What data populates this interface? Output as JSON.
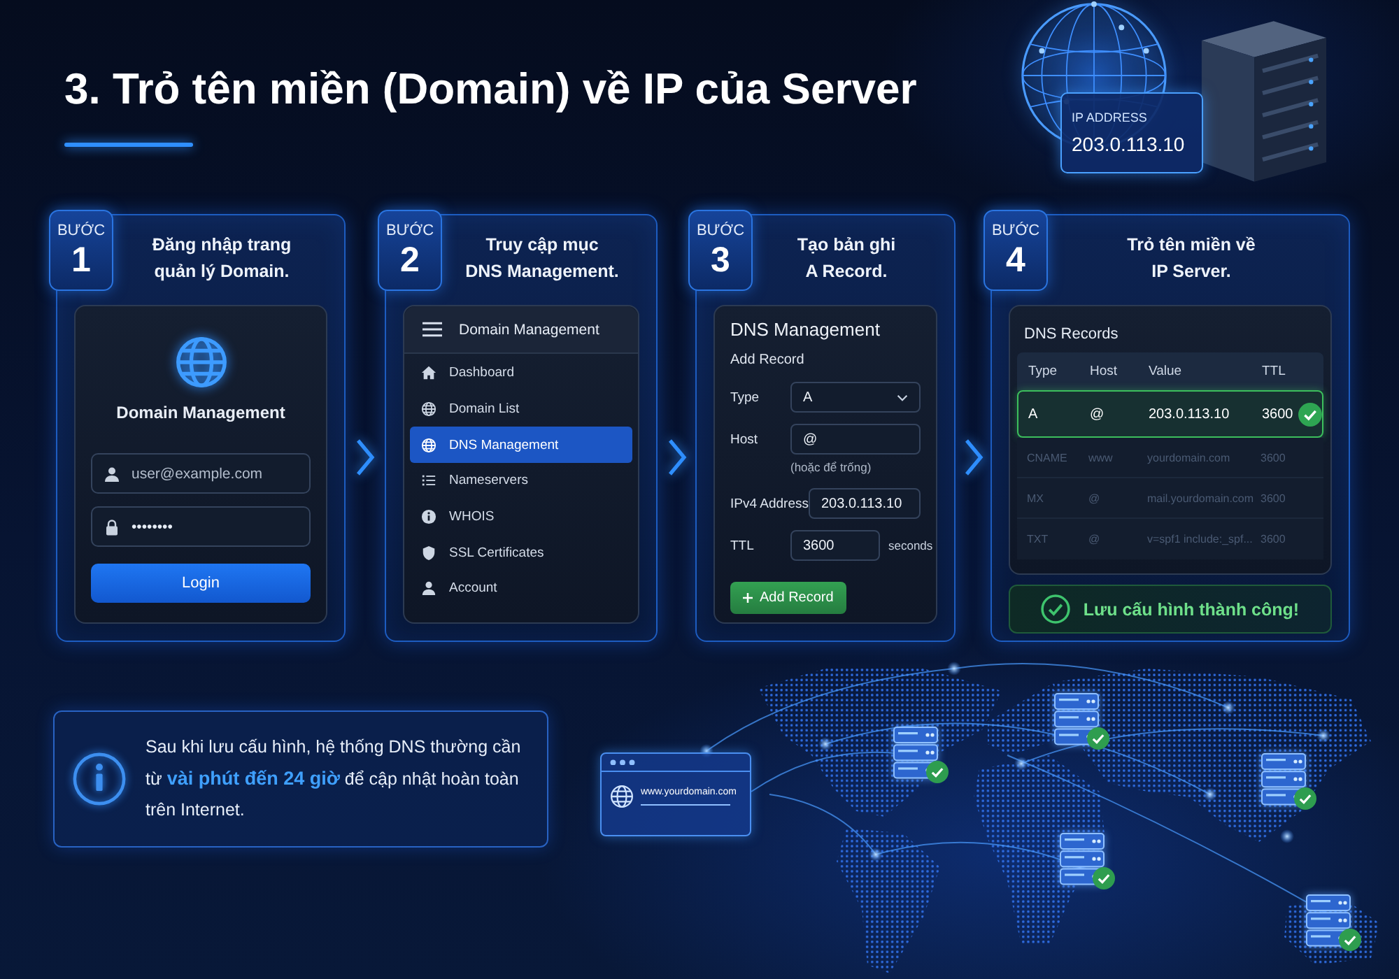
{
  "title": "3. Trỏ tên miền (Domain) về IP của Server",
  "hero": {
    "ip_label": "IP ADDRESS",
    "ip_value": "203.0.113.10"
  },
  "steps": [
    {
      "kind": "login",
      "step_label": "BƯỚC",
      "number": "1",
      "heading": "Đăng nhập trang\nquản lý Domain.",
      "panel": {
        "title": "Domain Management",
        "fields": [
          {
            "kind": "user",
            "placeholder": "user@example.com"
          },
          {
            "kind": "password",
            "value": "••••••••"
          }
        ],
        "button": "Login"
      }
    },
    {
      "kind": "menu",
      "step_label": "BƯỚC",
      "number": "2",
      "heading": "Truy cập mục\nDNS Management.",
      "panel": {
        "title": "Domain Management",
        "items": [
          {
            "label": "Dashboard",
            "selected": false
          },
          {
            "label": "Domain List",
            "selected": false
          },
          {
            "label": "DNS Management",
            "selected": true
          },
          {
            "label": "Nameservers",
            "selected": false
          },
          {
            "label": "WHOIS",
            "selected": false
          },
          {
            "label": "SSL Certificates",
            "selected": false
          },
          {
            "label": "Account",
            "selected": false
          }
        ]
      }
    },
    {
      "kind": "form",
      "step_label": "BƯỚC",
      "number": "3",
      "heading": "Tạo bản ghi\nA Record.",
      "panel": {
        "title": "DNS Management",
        "subtitle": "Add Record",
        "fields": [
          {
            "kind": "select",
            "label": "Type",
            "value": "A"
          },
          {
            "kind": "text",
            "label": "Host",
            "value": "@",
            "hint": "(hoặc để trống)"
          },
          {
            "kind": "text",
            "label": "IPv4 Address",
            "value": "203.0.113.10"
          },
          {
            "kind": "text",
            "label": "TTL",
            "value": "3600",
            "unit": "seconds"
          }
        ],
        "button": "Add Record"
      }
    },
    {
      "kind": "records",
      "step_label": "BƯỚC",
      "number": "4",
      "heading": "Trỏ tên miền về\nIP Server.",
      "panel": {
        "title": "DNS Records",
        "columns": [
          "Type",
          "Host",
          "Value",
          "TTL"
        ],
        "rows": [
          {
            "cells": [
              "A",
              "@",
              "203.0.113.10",
              "3600"
            ],
            "selected": true
          },
          {
            "cells": [
              "CNAME",
              "www",
              "yourdomain.com",
              "3600"
            ],
            "selected": false
          },
          {
            "cells": [
              "MX",
              "@",
              "mail.yourdomain.com",
              "3600"
            ],
            "selected": false
          },
          {
            "cells": [
              "TXT",
              "@",
              "v=spf1 include:_spf...",
              "3600"
            ],
            "selected": false
          }
        ],
        "success": "Lưu cấu hình thành công!"
      }
    }
  ],
  "info": {
    "text": "Sau khi lưu cấu hình, hệ thống DNS thường cần từ **vài phút đến 24 giờ** để cập nhật hoàn toàn trên Internet."
  },
  "map": {
    "browser_url": "www.yourdomain.com",
    "servers": [
      {
        "verified": true
      },
      {
        "verified": true
      },
      {
        "verified": true
      },
      {
        "verified": true
      },
      {
        "verified": true
      }
    ]
  }
}
